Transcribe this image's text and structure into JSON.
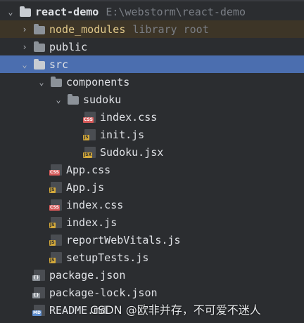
{
  "tree": {
    "root": {
      "name": "react-demo",
      "path": "E:\\webstorm\\react-demo"
    },
    "node_modules": {
      "name": "node_modules",
      "hint": "library root"
    },
    "public": {
      "name": "public"
    },
    "src": {
      "name": "src"
    },
    "components": {
      "name": "components"
    },
    "sudoku": {
      "name": "sudoku"
    },
    "files": {
      "index_css_sub": {
        "name": "index.css",
        "badge": "CSS"
      },
      "init_js": {
        "name": "init.js",
        "badge": "JS"
      },
      "sudoku_jsx": {
        "name": "Sudoku.jsx",
        "badge": "JSX"
      },
      "app_css": {
        "name": "App.css",
        "badge": "CSS"
      },
      "app_js": {
        "name": "App.js",
        "badge": "JS"
      },
      "index_css": {
        "name": "index.css",
        "badge": "CSS"
      },
      "index_js": {
        "name": "index.js",
        "badge": "JS"
      },
      "report": {
        "name": "reportWebVitals.js",
        "badge": "JS"
      },
      "setup": {
        "name": "setupTests.js",
        "badge": "JS"
      },
      "pkg": {
        "name": "package.json",
        "badge": "{}"
      },
      "pkglock": {
        "name": "package-lock.json",
        "badge": "{}"
      },
      "readme": {
        "name": "README.md",
        "badge": "MD"
      }
    }
  },
  "watermark": "CSDN @欧非并存，不可爱不迷人",
  "colors": {
    "background": "#2b2d30",
    "selection": "#4b6eaf",
    "excluded_row": "#3d3527",
    "text": "#dfe1e5",
    "hint": "#7a7e85"
  }
}
